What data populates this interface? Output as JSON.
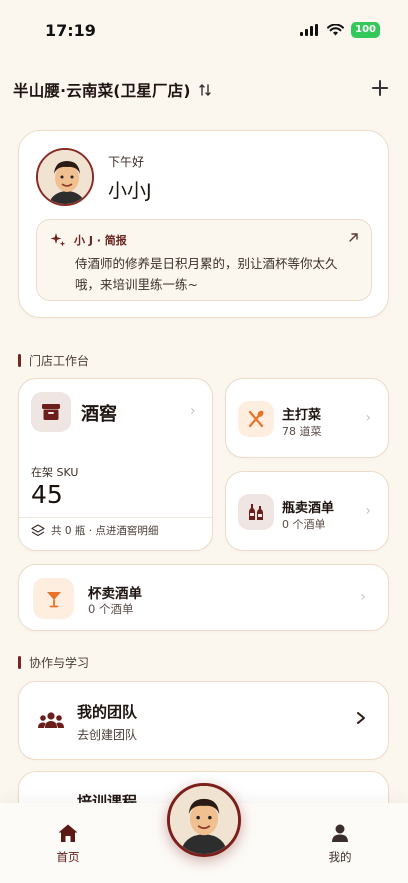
{
  "status_bar": {
    "time": "17:19",
    "battery": "100"
  },
  "header": {
    "store_name": "半山腰·云南菜(卫星厂店)"
  },
  "greeting": {
    "salutation": "下午好",
    "name": "小小J",
    "brief_title": "小 J · 简报",
    "brief_body": "侍酒师的修养是日积月累的，别让酒杯等你太久哦，来培训里练一练~"
  },
  "sections": {
    "workbench": "门店工作台",
    "collab": "协作与学习"
  },
  "cellar": {
    "title": "酒窖",
    "sku_label": "在架 SKU",
    "sku_value": "45",
    "footer": "共 0 瓶 · 点进酒窖明细"
  },
  "main_dishes": {
    "title": "主打菜",
    "subtitle": "78 道菜"
  },
  "bottle_list": {
    "title": "瓶卖酒单",
    "subtitle": "0 个酒单"
  },
  "glass_list": {
    "title": "杯卖酒单",
    "subtitle": "0 个酒单"
  },
  "team": {
    "title": "我的团队",
    "subtitle": "去创建团队"
  },
  "training": {
    "title": "培训课程"
  },
  "nav": {
    "home": "首页",
    "mine": "我的"
  },
  "colors": {
    "accent": "#7a2520",
    "background": "#fbf7ef",
    "orange": "#e8742a"
  },
  "icons": [
    "signal-icon",
    "wifi-icon",
    "swap-icon",
    "plus-icon",
    "sparkle-icon",
    "arrow-up-right-icon",
    "archive-box-icon",
    "layers-icon",
    "utensils-icon",
    "wine-bottles-icon",
    "cocktail-glass-icon",
    "team-icon",
    "home-icon",
    "user-icon",
    "chevron-right-icon"
  ]
}
